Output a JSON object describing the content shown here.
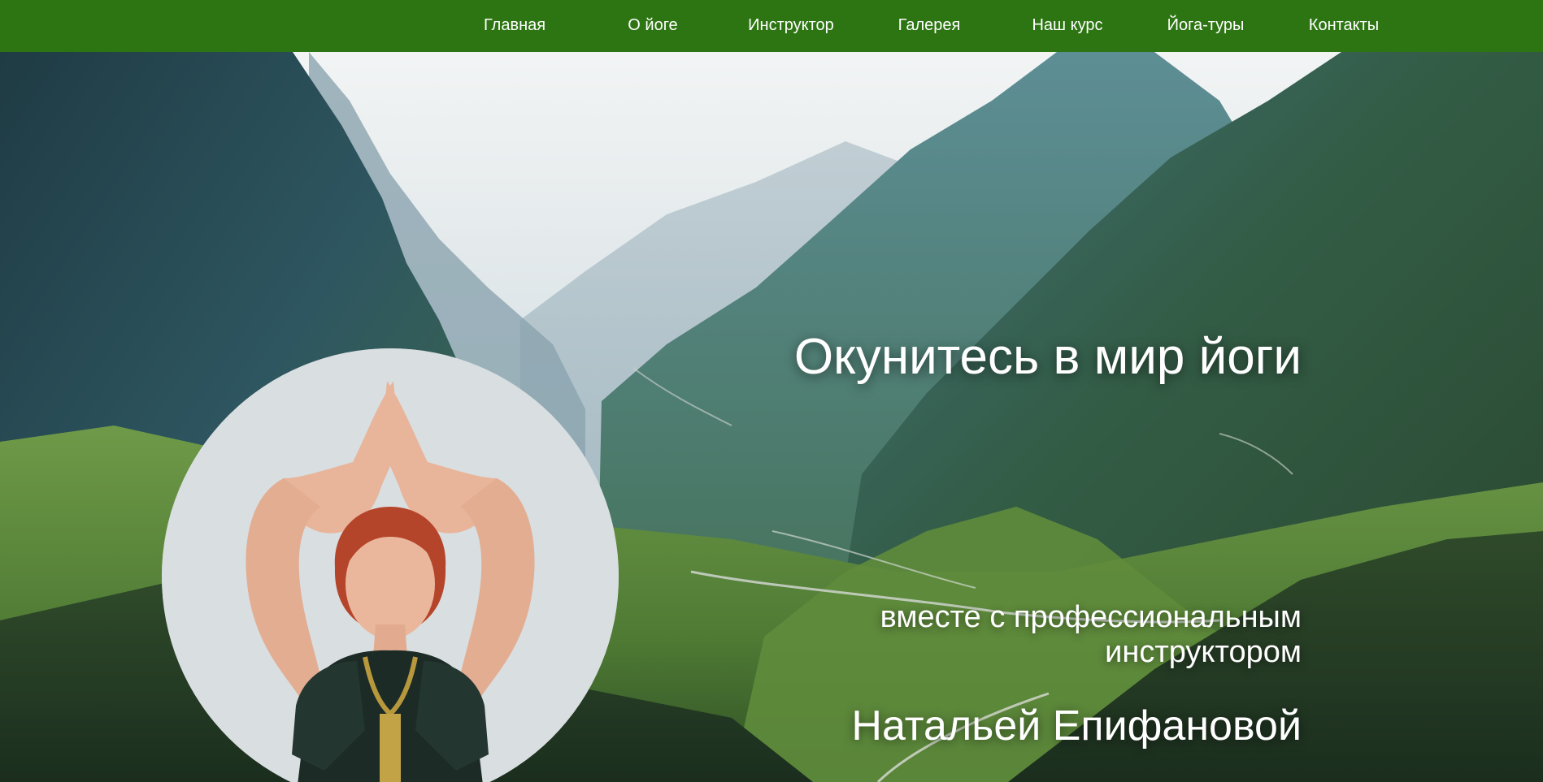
{
  "nav": {
    "items": [
      "Главная",
      "О йоге",
      "Инструктор",
      "Галерея",
      "Наш курс",
      "Йога-туры",
      "Контакты"
    ]
  },
  "hero": {
    "headline": "Окунитесь в мир йоги",
    "subline_1": "вместе с профессиональным",
    "subline_2": "инструктором",
    "instructor_name": "Натальей Епифановой"
  },
  "colors": {
    "nav_background": "#2d7512",
    "text": "#ffffff"
  }
}
